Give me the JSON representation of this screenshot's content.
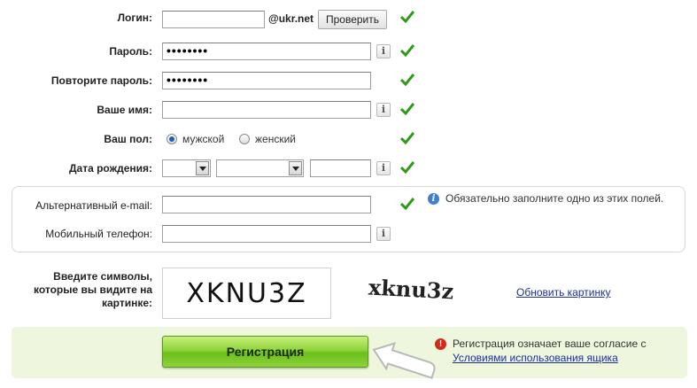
{
  "form": {
    "login": {
      "label": "Логин:",
      "value": "",
      "domain": "@ukr.net",
      "check_button": "Проверить"
    },
    "password": {
      "label": "Пароль:",
      "value": "••••••••",
      "info": "i"
    },
    "repeat_password": {
      "label": "Повторите пароль:",
      "value": "••••••••"
    },
    "name": {
      "label": "Ваше имя:",
      "value": "",
      "info": "i"
    },
    "gender": {
      "label": "Ваш пол:",
      "options": [
        "мужской",
        "женский"
      ],
      "selected": "мужской"
    },
    "birthdate": {
      "label": "Дата рождения:",
      "day": "",
      "month": "",
      "year": "",
      "info": "i"
    },
    "alt_email": {
      "label": "Альтернативный e-mail:",
      "value": ""
    },
    "mobile": {
      "label": "Мобильный телефон:",
      "value": "",
      "info": "i"
    },
    "group_note": {
      "icon": "i",
      "text": "Обязательно заполните одно из этих полей."
    },
    "captcha": {
      "label_lines": [
        "Введите символы,",
        "которые вы видите на",
        "картинке:"
      ],
      "image_text": "XKNU3Z",
      "typed_text": "xknu3z",
      "refresh_link": "Обновить картинку"
    },
    "register": {
      "button": "Регистрация",
      "warning_icon": "!",
      "notice_text": "Регистрация означает ваше согласие с",
      "notice_link": "Условиями использования ящика"
    }
  },
  "colors": {
    "check": "#2f9a1a",
    "register_green": "#8fd43a",
    "notice_bg": "#eef7dd",
    "link": "#1a2fa0"
  },
  "icons": {
    "valid": "check-icon",
    "info": "info-icon",
    "warning": "warning-icon",
    "pointer": "arrow-pointer-icon"
  }
}
